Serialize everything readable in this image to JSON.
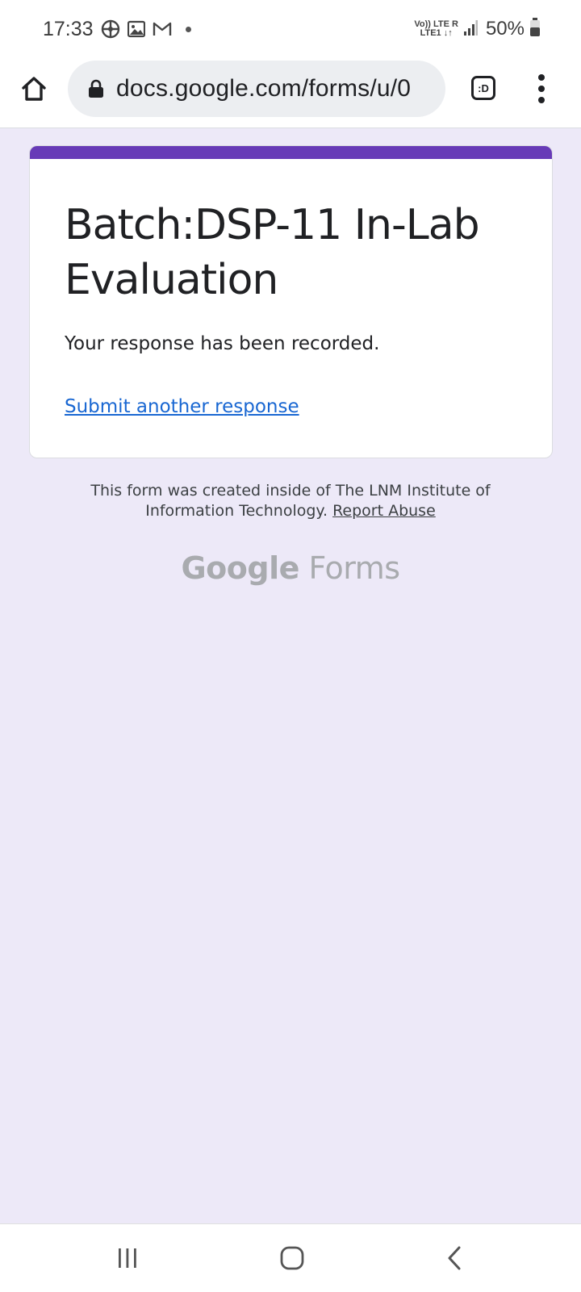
{
  "status_bar": {
    "time": "17:33",
    "network_line1": "Vo)) LTE R",
    "network_line2": "LTE1 ↓↑",
    "battery": "50%"
  },
  "browser": {
    "url": "docs.google.com/forms/u/0",
    "tab_switcher_label": ":D"
  },
  "form": {
    "title": "Batch:DSP-11 In-Lab Evaluation",
    "confirmation": "Your response has been recorded.",
    "submit_another": "Submit another response",
    "accent_color": "#673ab7"
  },
  "footer": {
    "note": "This form was created inside of The LNM Institute of Information Technology.",
    "report_abuse": "Report Abuse",
    "brand_google": "Google",
    "brand_forms": "Forms"
  },
  "icons": {
    "status": [
      "steering-wheel-icon",
      "gallery-icon",
      "gmail-icon"
    ],
    "toolbar": [
      "home-icon",
      "lock-icon",
      "tab-switcher-icon",
      "more-vert-icon"
    ],
    "nav": [
      "recent-apps-icon",
      "home-nav-icon",
      "back-icon"
    ]
  }
}
